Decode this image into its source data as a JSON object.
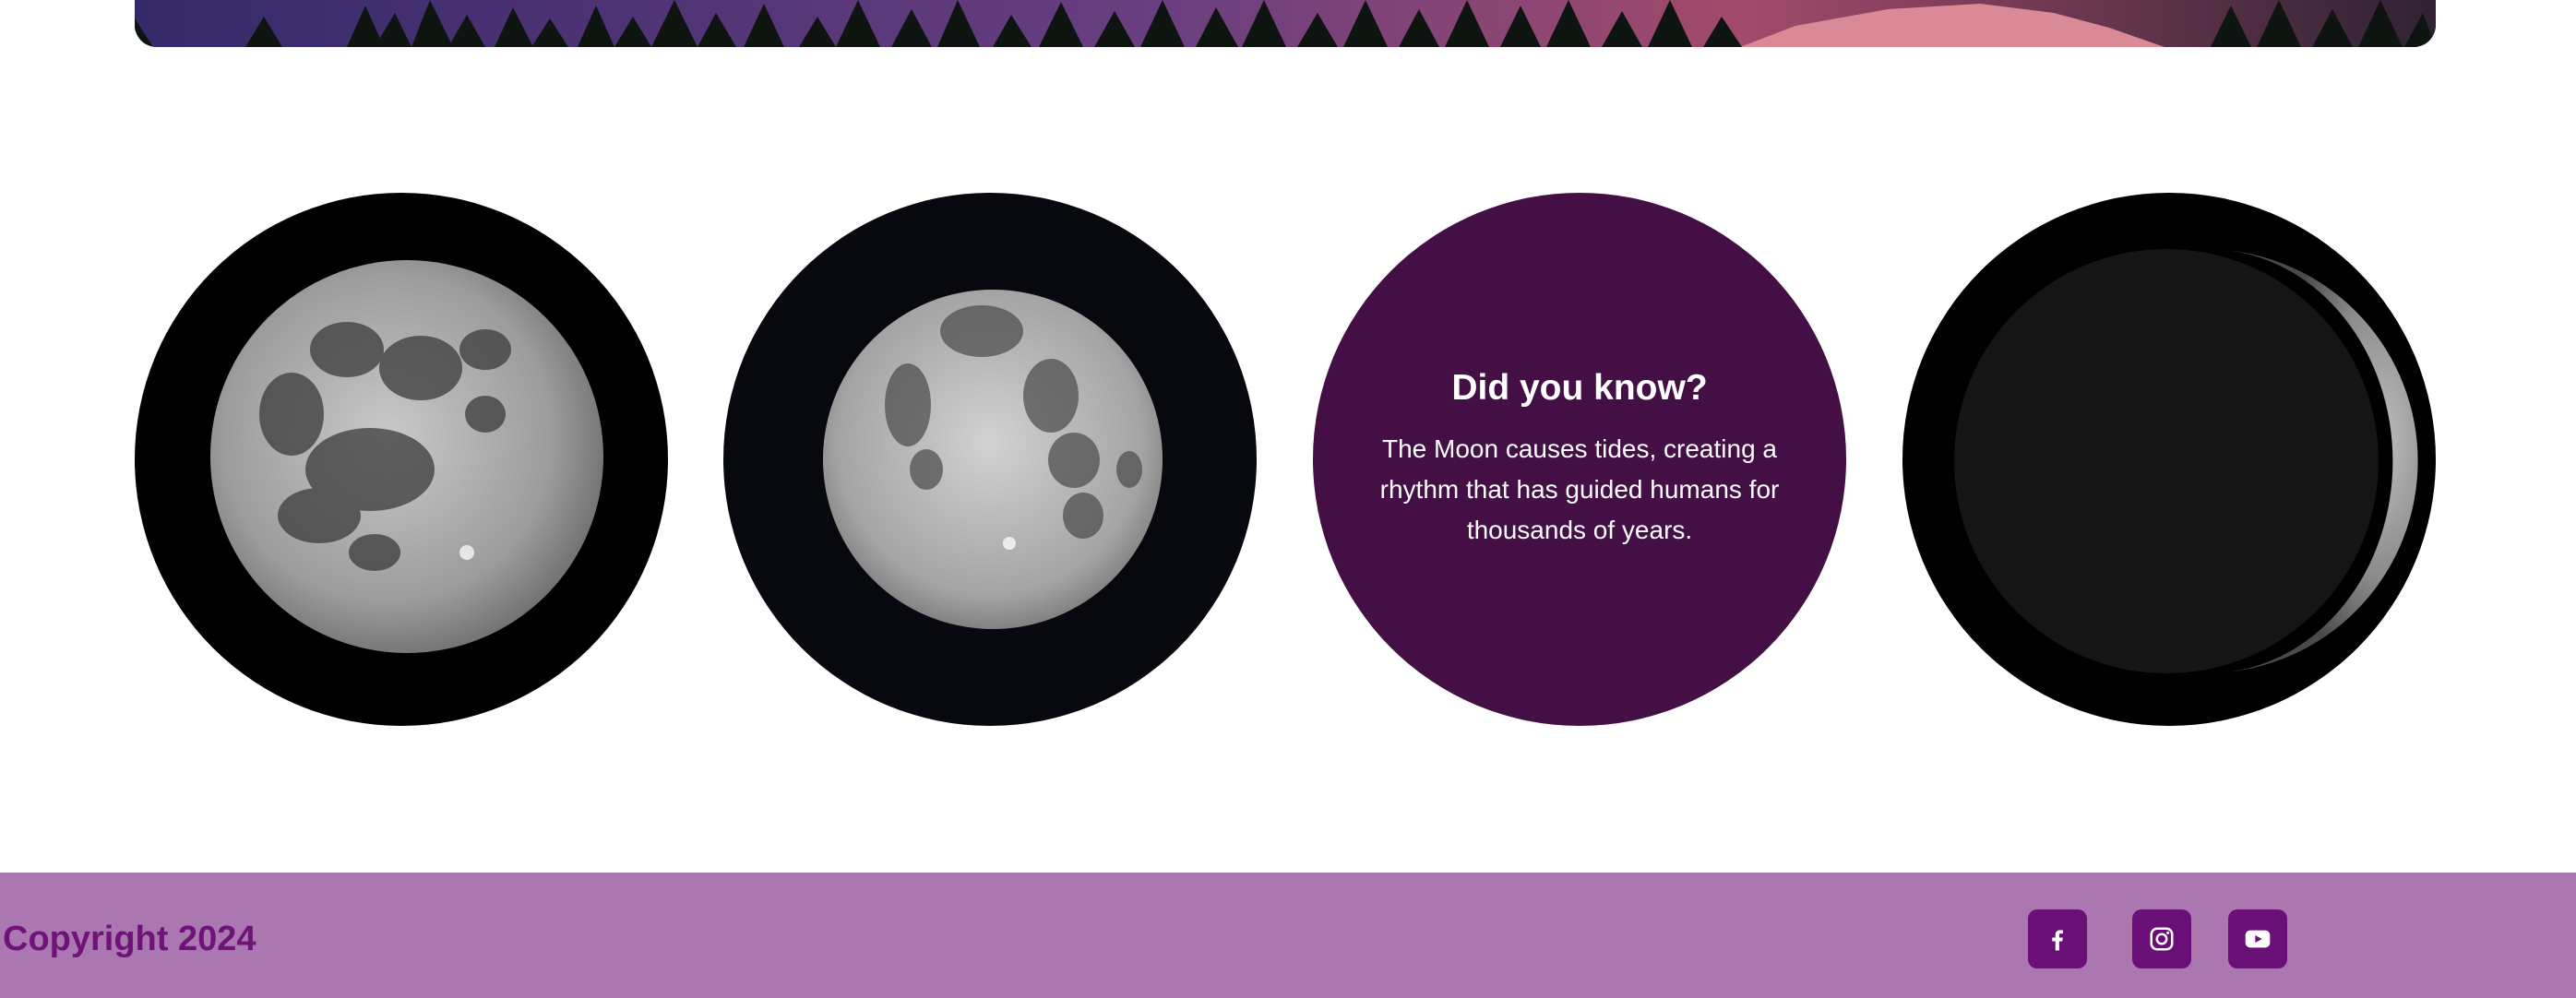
{
  "hero": {
    "image_name": "snowy-forest-sunset-image"
  },
  "gallery": {
    "items": [
      {
        "kind": "image",
        "name": "full-moon-image"
      },
      {
        "kind": "image",
        "name": "gibbous-moon-image"
      },
      {
        "kind": "fact",
        "title": "Did you know?",
        "text": "The Moon causes tides, creating a rhythm that has guided humans for thousands of years."
      },
      {
        "kind": "image",
        "name": "crescent-moon-image"
      }
    ]
  },
  "footer": {
    "copyright": "Copyright 2024",
    "social": [
      {
        "name": "facebook-icon"
      },
      {
        "name": "instagram-icon"
      },
      {
        "name": "youtube-icon"
      }
    ]
  },
  "colors": {
    "accent": "#6a0f78",
    "fact_bg": "#440f45",
    "footer_bg": "#ab77b0",
    "copyright_text": "#6f137b"
  }
}
